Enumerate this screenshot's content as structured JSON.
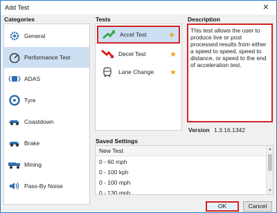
{
  "window": {
    "title": "Add Test",
    "close_glyph": "✕"
  },
  "labels": {
    "categories": "Categories",
    "tests": "Tests",
    "description": "Description",
    "version_label": "Version",
    "saved_settings": "Saved Settings"
  },
  "categories": [
    {
      "label": "General",
      "icon": "gear-icon",
      "selected": false
    },
    {
      "label": "Performance Test",
      "icon": "speedometer-icon",
      "selected": true
    },
    {
      "label": "ADAS",
      "icon": "adas-icon",
      "selected": false
    },
    {
      "label": "Tyre",
      "icon": "tyre-icon",
      "selected": false
    },
    {
      "label": "Coastdown",
      "icon": "coastdown-icon",
      "selected": false
    },
    {
      "label": "Brake",
      "icon": "brake-icon",
      "selected": false
    },
    {
      "label": "Mining",
      "icon": "mining-truck-icon",
      "selected": false
    },
    {
      "label": "Pass-By Noise",
      "icon": "speaker-icon",
      "selected": false
    }
  ],
  "tests": [
    {
      "label": "Accel Test",
      "icon": "accel-arrow-icon",
      "selected": true,
      "favorite": true
    },
    {
      "label": "Decel Test",
      "icon": "decel-arrow-icon",
      "selected": false,
      "favorite": true
    },
    {
      "label": "Lane Change",
      "icon": "lane-change-icon",
      "selected": false,
      "favorite": true
    }
  ],
  "description": {
    "text": "This test allows the user to produce live or post processed results from either a speed to speed, speed to distance, or speed to the end of acceleration test.",
    "version": "1.3.16.1342"
  },
  "saved_settings": {
    "rows": [
      "New Test",
      "0 - 60 mph",
      "0 - 100 kph",
      "0 - 100 mph",
      "0 - 130 mph"
    ]
  },
  "buttons": {
    "ok": "OK",
    "cancel": "Cancel"
  },
  "colors": {
    "accent_blue": "#2b78c8",
    "selection": "#cde0f3",
    "highlight_red": "#d42020",
    "star": "#f0a21c"
  }
}
